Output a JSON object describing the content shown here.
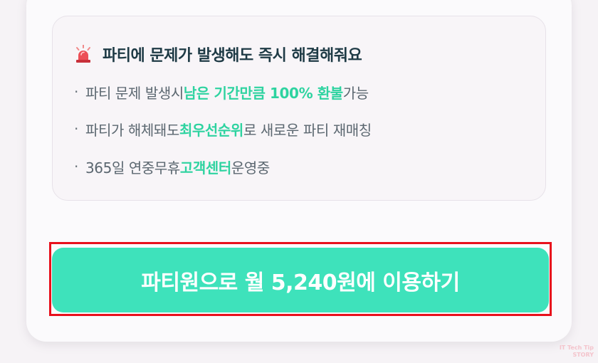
{
  "info_box": {
    "title": "파티에 문제가 발생해도 즉시 해결해줘요",
    "icon": "siren-icon",
    "items": [
      {
        "bullet": "·",
        "before": "파티 문제 발생시 ",
        "highlight": "남은 기간만큼 100% 환불",
        "after": " 가능"
      },
      {
        "bullet": "·",
        "before": "파티가 해체돼도 ",
        "highlight": "최우선순위",
        "after": "로 새로운 파티 재매칭"
      },
      {
        "bullet": "·",
        "before": "365일 연중무휴 ",
        "highlight": "고객센터",
        "after": " 운영중"
      }
    ]
  },
  "cta": {
    "label": "파티원으로 월 5,240원에 이용하기"
  },
  "watermark": {
    "line1": "IT Tech Tip",
    "line2": "STORY"
  },
  "colors": {
    "accent": "#3ee2bb",
    "highlight_text": "#2ed3a0",
    "frame": "#e8101c",
    "title_text": "#1e3a45"
  }
}
